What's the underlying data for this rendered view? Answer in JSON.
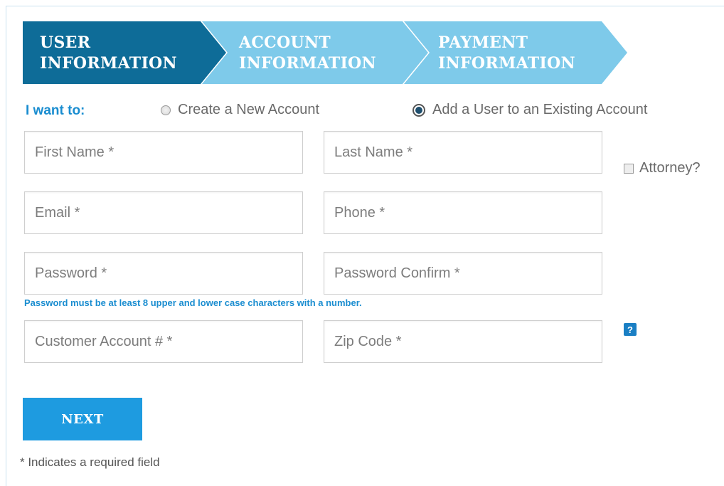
{
  "steps": [
    {
      "line1": "USER",
      "line2": "INFORMATION",
      "active": true
    },
    {
      "line1": "ACCOUNT",
      "line2": "INFORMATION",
      "active": false
    },
    {
      "line1": "PAYMENT",
      "line2": "INFORMATION",
      "active": false
    }
  ],
  "intent": {
    "label": "I want to:",
    "options": [
      {
        "label": "Create a New Account",
        "checked": false
      },
      {
        "label": "Add a User to an Existing Account",
        "checked": true
      }
    ]
  },
  "fields": {
    "first_name": {
      "placeholder": "First Name *",
      "value": ""
    },
    "last_name": {
      "placeholder": "Last Name *",
      "value": ""
    },
    "email": {
      "placeholder": "Email *",
      "value": ""
    },
    "phone": {
      "placeholder": "Phone *",
      "value": ""
    },
    "password": {
      "placeholder": "Password *",
      "value": ""
    },
    "password_confirm": {
      "placeholder": "Password Confirm *",
      "value": ""
    },
    "customer_account": {
      "placeholder": "Customer Account # *",
      "value": ""
    },
    "zip_code": {
      "placeholder": "Zip Code *",
      "value": ""
    }
  },
  "attorney": {
    "label": "Attorney?",
    "checked": false
  },
  "password_hint": "Password must be at least 8 upper and lower case characters with a number.",
  "help_icon": {
    "glyph": "?"
  },
  "next_button": {
    "label": "NEXT"
  },
  "footnote": "* Indicates a required field",
  "colors": {
    "active_step": "#0e6c98",
    "inactive_step": "#7ecaea",
    "accent_blue": "#1a8dd0",
    "button": "#1e9be0"
  }
}
